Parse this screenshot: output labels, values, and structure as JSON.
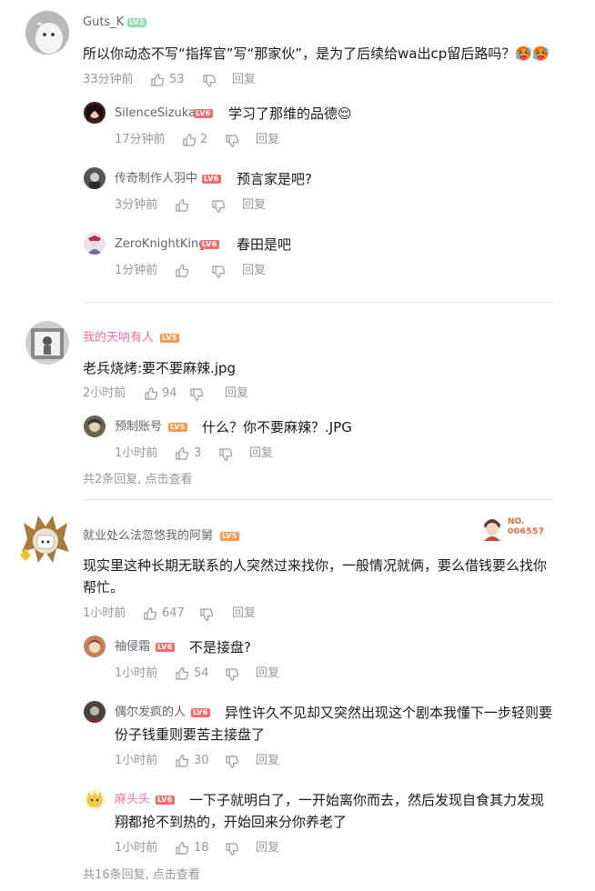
{
  "reply_label": "回复",
  "comments": [
    {
      "user": "Guts_K",
      "level": "LV2",
      "text": "所以你动态不写“指挥官”写“那家伙”，是为了后续给wa出cp留后路吗？",
      "emojis": "🥵🥵",
      "time": "33分钟前",
      "likes": "53",
      "replies": [
        {
          "user": "SilenceSizuka",
          "level": "LV6",
          "text": "学习了那维的品德",
          "emojis": "😌",
          "time": "17分钟前",
          "likes": "2"
        },
        {
          "user": "传奇制作人羽中",
          "level": "LV6",
          "text": "预言家是吧?",
          "time": "3分钟前",
          "likes": ""
        },
        {
          "user": "ZeroKnightKing",
          "level": "LV6",
          "text": "春田是吧",
          "time": "1分钟前",
          "likes": ""
        }
      ]
    },
    {
      "user": "我的天呐有人",
      "level": "LV5",
      "text": "老兵烧烤:要不要麻辣.jpg",
      "time": "2小时前",
      "likes": "94",
      "replies": [
        {
          "user": "预制账号",
          "level": "LV5",
          "text": "什么？你不要麻辣？.JPG",
          "time": "1小时前",
          "likes": "3"
        }
      ],
      "view_more": "共2条回复, 点击查看"
    },
    {
      "user": "就业处么法忽悠我的阿舅",
      "level": "LV5",
      "badge_text": "NO.",
      "badge_number": "006557",
      "text_line1": "现实里这种长期无联系的人突然过来找你，一般情况就俩，要么借钱要么找你",
      "text_line2": "帮忙。",
      "time": "1小时前",
      "likes": "647",
      "replies": [
        {
          "user": "袖侵霜",
          "level": "LV6",
          "text": "不是接盘?",
          "time": "1小时前",
          "likes": "54"
        },
        {
          "user": "偶尔发疯的人",
          "level": "LV6",
          "text_line1": "异性许久不见却又突然出现这个剧本我懂下一步轻则要",
          "text_line2": "份子钱重则要苦主接盘了",
          "time": "1小时前",
          "likes": "30"
        },
        {
          "user": "麻头头",
          "level": "LV6",
          "text_line1": "一下子就明白了，一开始离你而去，然后发现自食其力发现",
          "text_line2": "翔都抢不到热的，开始回来分你养老了",
          "time": "1小时前",
          "likes": "18"
        }
      ],
      "view_more": "共16条回复, 点击查看"
    }
  ]
}
